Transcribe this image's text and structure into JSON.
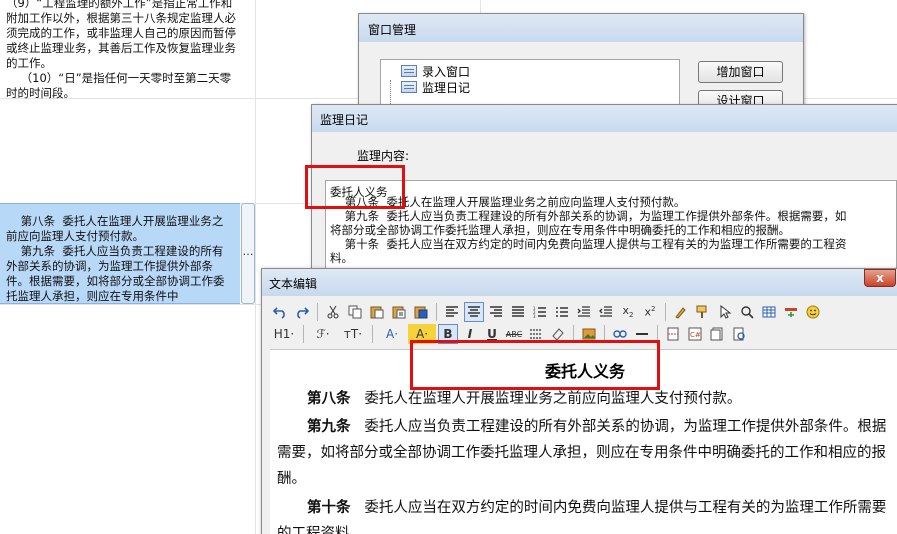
{
  "background": {
    "top_text": "（9）“工程监理的额外工作”是指正常工作和附加工作以外，根据第三十八条规定监理人必须完成的工作，或非监理人自己的原因而暂停或终止监理业务，其善后工作及恢复监理业务的工作。\n    （10）“日”是指任何一天零时至第二天零时的时间段。",
    "selected_cell_text": "    第八条  委托人在监理人开展监理业务之前应向监理人支付预付款。\n    第九条  委托人应当负责工程建设的所有外部关系的协调，为监理工作提供外部条件。根据需要，如将部分或全部协调工作委托监理人承担，则应在专用条件中",
    "cell_button_label": "…"
  },
  "window_manager": {
    "title": "窗口管理",
    "tree_items": [
      "录入窗口",
      "监理日记"
    ],
    "buttons": [
      "增加窗口",
      "设计窗口"
    ]
  },
  "diary": {
    "title": "监理日记",
    "content_label": "监理内容:",
    "content_heading": "委托人义务",
    "content_lines": [
      "    第八条  委托人在监理人开展监理业务之前应向监理人支付预付款。",
      "    第九条  委托人应当负责工程建设的所有外部关系的协调，为监理工作提供外部条件。根据需要，如",
      "将部分或全部协调工作委托监理人承担，则应在专用条件中明确委托的工作和相应的报酬。",
      "    第十条  委托人应当在双方约定的时间内免费向监理人提供与工程有关的为监理工作所需要的工程资",
      "料。"
    ]
  },
  "editor": {
    "title": "文本编辑",
    "close_label": "x",
    "toolbar_row2": {
      "heading": "H1·",
      "font": "ℱ·",
      "size": "тT·",
      "font_color": "A·",
      "highlight": "A·",
      "bold": "B",
      "italic": "I",
      "underline": "U",
      "strike": "ABC"
    },
    "document": {
      "title": "委托人义务",
      "paragraphs": [
        {
          "article": "第八条",
          "text": "委托人在监理人开展监理业务之前应向监理人支付预付款。"
        },
        {
          "article": "第九条",
          "text": "委托人应当负责工程建设的所有外部关系的协调，为监理工作提供外部条件。根据需要，如将部分或全部协调工作委托监理人承担，则应在专用条件中明确委托的工作和相应的报酬。"
        },
        {
          "article": "第十条",
          "text": "委托人应当在双方约定的时间内免费向监理人提供与工程有关的为监理工作所需要的工程资料。"
        }
      ]
    }
  },
  "colors": {
    "highlight_box": "#e01010",
    "selection": "#b8d8f8",
    "titlebar": "#c8d9ee"
  }
}
